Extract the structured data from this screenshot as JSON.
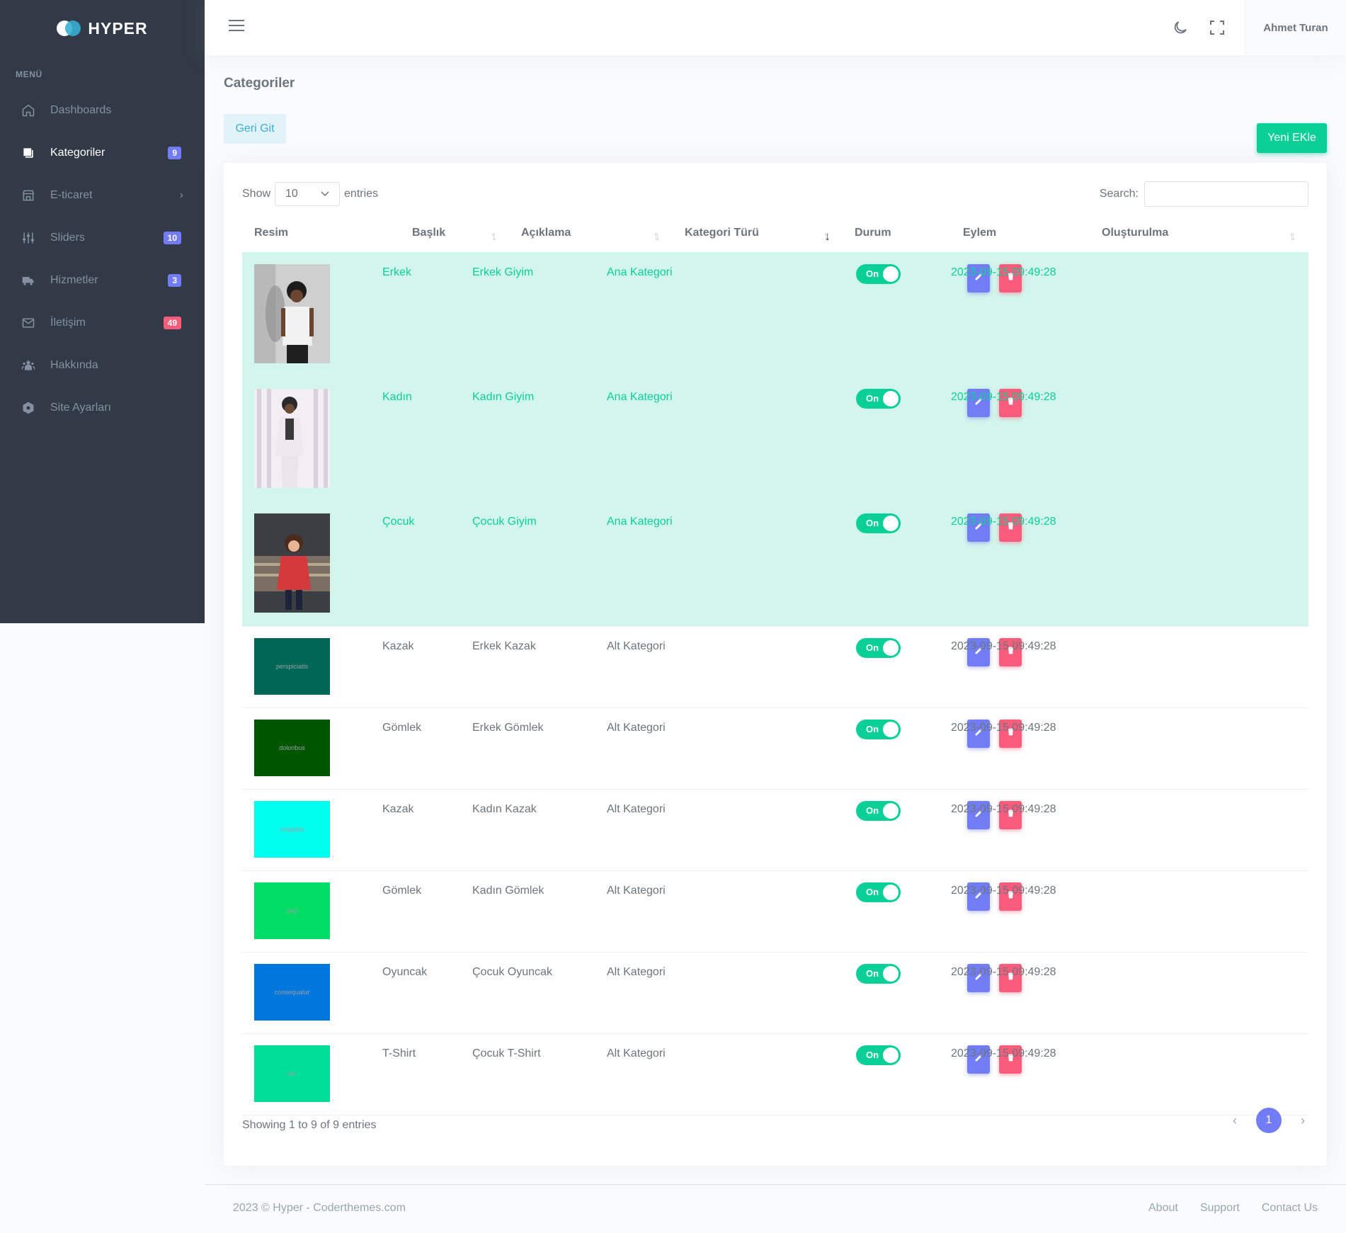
{
  "brand": {
    "name": "HYPER"
  },
  "sidebar": {
    "menu_title": "MENÜ",
    "items": [
      {
        "label": "Dashboards",
        "icon": "home-icon",
        "badge": null
      },
      {
        "label": "Kategoriler",
        "icon": "copy-icon",
        "badge": "9",
        "badge_color": "#727cf5",
        "active": true
      },
      {
        "label": "E-ticaret",
        "icon": "store-icon",
        "badge": null,
        "chevron": "›"
      },
      {
        "label": "Sliders",
        "icon": "sliders-icon",
        "badge": "10",
        "badge_color": "#727cf5"
      },
      {
        "label": "Hizmetler",
        "icon": "truck-icon",
        "badge": "3",
        "badge_color": "#727cf5"
      },
      {
        "label": "İletişim",
        "icon": "mail-icon",
        "badge": "49",
        "badge_color": "#fa5c7c"
      },
      {
        "label": "Hakkında",
        "icon": "users-icon",
        "badge": null
      },
      {
        "label": "Site Ayarları",
        "icon": "hexagon-settings-icon",
        "badge": null
      }
    ]
  },
  "topbar": {
    "user_name": "Ahmet Turan"
  },
  "page": {
    "title": "Categoriler",
    "back_button": "Geri Git",
    "new_button": "Yeni EKle"
  },
  "datatable": {
    "show_label": "Show",
    "length_value": "10",
    "entries_label": "entries",
    "search_label": "Search:",
    "search_value": "",
    "columns": [
      "Resim",
      "Başlık",
      "Açıklama",
      "Kategori Türü",
      "Durum",
      "Eylem",
      "Oluşturulma"
    ],
    "toggle_label": "On",
    "rows": [
      {
        "image": "photo-man",
        "title": "Erkek",
        "desc": "Erkek Giyim",
        "type": "Ana Kategori",
        "date": "2023-09-15 09:49:28",
        "highlight": true
      },
      {
        "image": "photo-woman",
        "title": "Kadın",
        "desc": "Kadın Giyim",
        "type": "Ana Kategori",
        "date": "2023-09-15 09:49:28",
        "highlight": true
      },
      {
        "image": "photo-child",
        "title": "Çocuk",
        "desc": "Çocuk Giyim",
        "type": "Ana Kategori",
        "date": "2023-09-15 09:49:28",
        "highlight": true
      },
      {
        "image_text": "perspiciatis",
        "image_color": "#006655",
        "title": "Kazak",
        "desc": "Erkek Kazak",
        "type": "Alt Kategori",
        "date": "2023-09-15 09:49:28"
      },
      {
        "image_text": "doloribus",
        "image_color": "#005500",
        "title": "Gömlek",
        "desc": "Erkek Gömlek",
        "type": "Alt Kategori",
        "date": "2023-09-15 09:49:28"
      },
      {
        "image_text": "voluptas",
        "image_color": "#00ffee",
        "title": "Kazak",
        "desc": "Kadın Kazak",
        "type": "Alt Kategori",
        "date": "2023-09-15 09:49:28"
      },
      {
        "image_text": "sed",
        "image_color": "#00dd66",
        "title": "Gömlek",
        "desc": "Kadın Gömlek",
        "type": "Alt Kategori",
        "date": "2023-09-15 09:49:28"
      },
      {
        "image_text": "consequatur",
        "image_color": "#0077dd",
        "title": "Oyuncak",
        "desc": "Çocuk Oyuncak",
        "type": "Alt Kategori",
        "date": "2023-09-15 09:49:28"
      },
      {
        "image_text": "hic",
        "image_color": "#00dd99",
        "title": "T-Shirt",
        "desc": "Çocuk T-Shirt",
        "type": "Alt Kategori",
        "date": "2023-09-15 09:49:28"
      }
    ],
    "info": "Showing 1 to 9 of 9 entries",
    "pagination": {
      "prev": "‹",
      "current": "1",
      "next": "›"
    }
  },
  "footer": {
    "copyright": "2023 © Hyper - Coderthemes.com",
    "links": [
      "About",
      "Support",
      "Contact Us"
    ]
  }
}
